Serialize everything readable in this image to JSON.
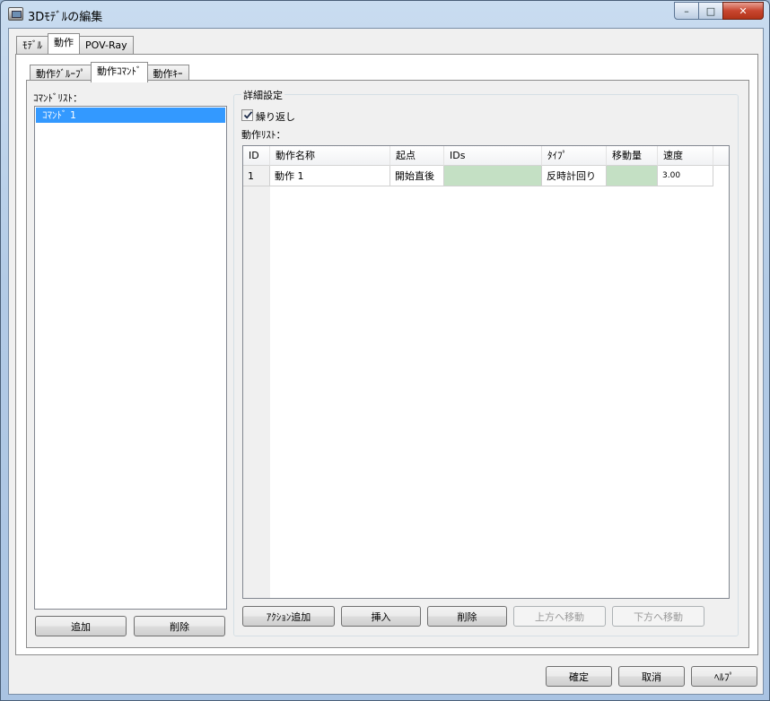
{
  "window": {
    "title": "3Dﾓﾃﾞﾙの編集",
    "controls": {
      "minimize": "–",
      "maximize": "□",
      "close": "✕"
    }
  },
  "outer_tabs": [
    {
      "label": "ﾓﾃﾞﾙ",
      "active": false
    },
    {
      "label": "動作",
      "active": true
    },
    {
      "label": "POV-Ray",
      "active": false
    }
  ],
  "inner_tabs": [
    {
      "label": "動作ｸﾞﾙｰﾌﾟ",
      "active": false
    },
    {
      "label": "動作ｺﾏﾝﾄﾞ",
      "active": true
    },
    {
      "label": "動作ｷｰ",
      "active": false
    }
  ],
  "command_list": {
    "label": "ｺﾏﾝﾄﾞﾘｽﾄ：",
    "items": [
      "ｺﾏﾝﾄﾞ 1"
    ],
    "selected_index": 0,
    "add_label": "追加",
    "delete_label": "削除"
  },
  "details": {
    "group_title": "詳細設定",
    "repeat_label": "繰り返し",
    "repeat_checked": true,
    "action_list_label": "動作ﾘｽﾄ：",
    "columns": [
      "ID",
      "動作名称",
      "起点",
      "IDs",
      "ﾀｲﾌﾟ",
      "移動量",
      "速度"
    ],
    "rows": [
      {
        "id": "1",
        "name": "動作 1",
        "origin": "開始直後",
        "ids": "",
        "type": "反時計回り",
        "amount": "",
        "speed": "3.00"
      }
    ],
    "buttons": {
      "add_action": "ｱｸｼｮﾝ追加",
      "insert": "挿入",
      "delete": "削除",
      "move_up": "上方へ移動",
      "move_down": "下方へ移動"
    }
  },
  "footer": {
    "ok": "確定",
    "cancel": "取消",
    "help": "ﾍﾙﾌﾟ"
  }
}
